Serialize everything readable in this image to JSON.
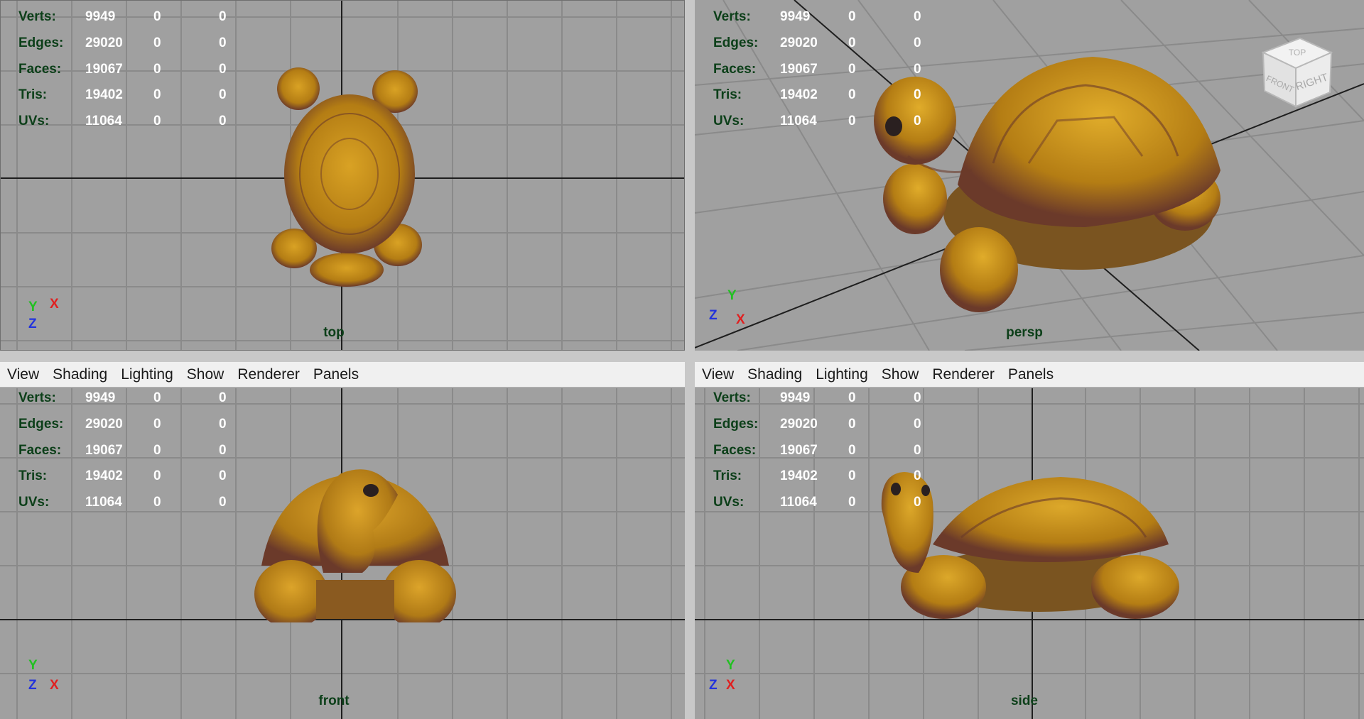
{
  "menu": [
    "View",
    "Shading",
    "Lighting",
    "Show",
    "Renderer",
    "Panels"
  ],
  "hud_rows": [
    {
      "label": "Verts:",
      "value": "9949",
      "sel": "0",
      "extra": "0"
    },
    {
      "label": "Edges:",
      "value": "29020",
      "sel": "0",
      "extra": "0"
    },
    {
      "label": "Faces:",
      "value": "19067",
      "sel": "0",
      "extra": "0"
    },
    {
      "label": "Tris:",
      "value": "19402",
      "sel": "0",
      "extra": "0"
    },
    {
      "label": "UVs:",
      "value": "11064",
      "sel": "0",
      "extra": "0"
    }
  ],
  "panels": {
    "top": {
      "camera": "top",
      "axes": [
        "Y",
        "X",
        "Z"
      ]
    },
    "persp": {
      "camera": "persp",
      "axes": [
        "Y",
        "Z",
        "X"
      ],
      "viewcube": [
        "TOP",
        "FRONT",
        "RIGHT"
      ]
    },
    "front": {
      "camera": "front",
      "axes": [
        "Y",
        "Z",
        "X"
      ]
    },
    "side": {
      "camera": "side",
      "axes": [
        "Y",
        "Z",
        "X"
      ]
    }
  },
  "colors": {
    "viewport_bg": "#a0a0a0",
    "grid": "#8a8a8a",
    "origin_axis": "#1e1e1e",
    "hud_label": "#0c3f19",
    "turtle_body": "#c8901a",
    "turtle_dark": "#6b3a2a",
    "active_border": "#8fb8d8"
  }
}
